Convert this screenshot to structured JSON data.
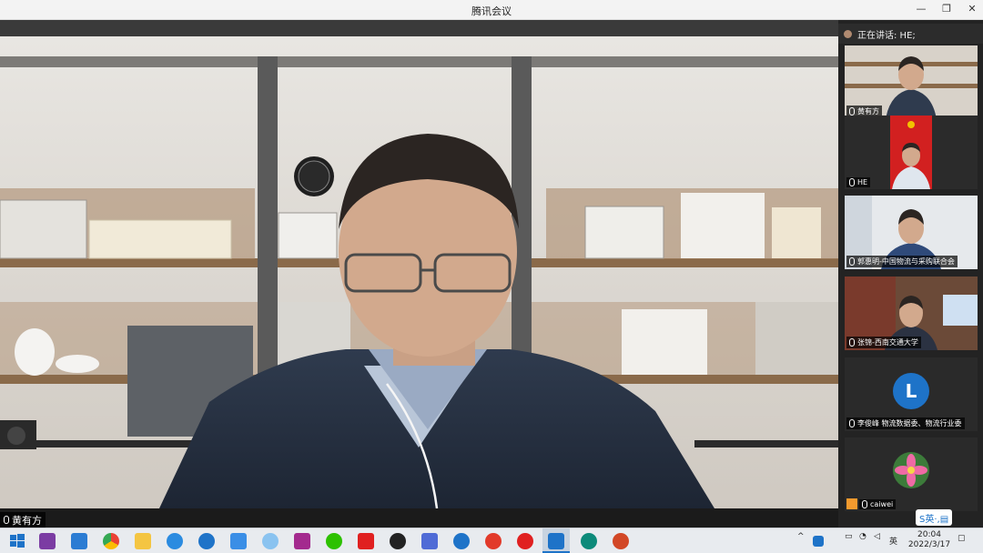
{
  "window": {
    "title": "腾讯会议",
    "minimize": "—",
    "restore": "❐",
    "close": "✕"
  },
  "main": {
    "speaker_name": "黄有方"
  },
  "side": {
    "talking_label": "正在讲话: HE;",
    "participants": [
      {
        "name": "黄有方",
        "avatar": ""
      },
      {
        "name": "HE",
        "avatar": ""
      },
      {
        "name": "郭惠明-中国物流与采购联合会",
        "avatar": ""
      },
      {
        "name": "张锦-西南交通大学",
        "avatar": ""
      },
      {
        "name": "李俊峰 物流数据委、物流行业委",
        "avatar": "L"
      },
      {
        "name": "caiwei",
        "avatar": ""
      }
    ]
  },
  "taskbar": {
    "ime_label": "S英·,▤",
    "lang": "英",
    "time": "20:04",
    "date": "2022/3/17",
    "colors": {
      "bg": "#e8ebef",
      "accent": "#1e73c8"
    }
  }
}
